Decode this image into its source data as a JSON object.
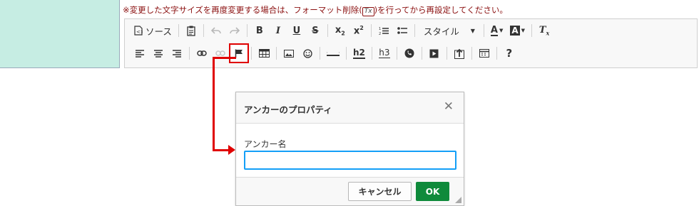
{
  "notice": {
    "text_before": "※変更した文字サイズを再度変更する場合は、フォーマット削除(",
    "kbd": "Tx",
    "text_after": ")を行ってから再設定してください。"
  },
  "toolbar": {
    "source_label": "ソース",
    "style_label": "スタイル",
    "bold": "B",
    "italic": "I",
    "underline": "U",
    "strike": "S",
    "h2": "h2",
    "h3": "h3",
    "help": "?"
  },
  "dialog": {
    "title": "アンカーのプロパティ",
    "field_label": "アンカー名",
    "field_value": "",
    "cancel_label": "キャンセル",
    "ok_label": "OK"
  },
  "colors": {
    "left_cell": "#c6ede3",
    "highlight": "#e00000",
    "ok": "#0f8a3b",
    "focus": "#139ff7",
    "notice": "#8b1010"
  }
}
